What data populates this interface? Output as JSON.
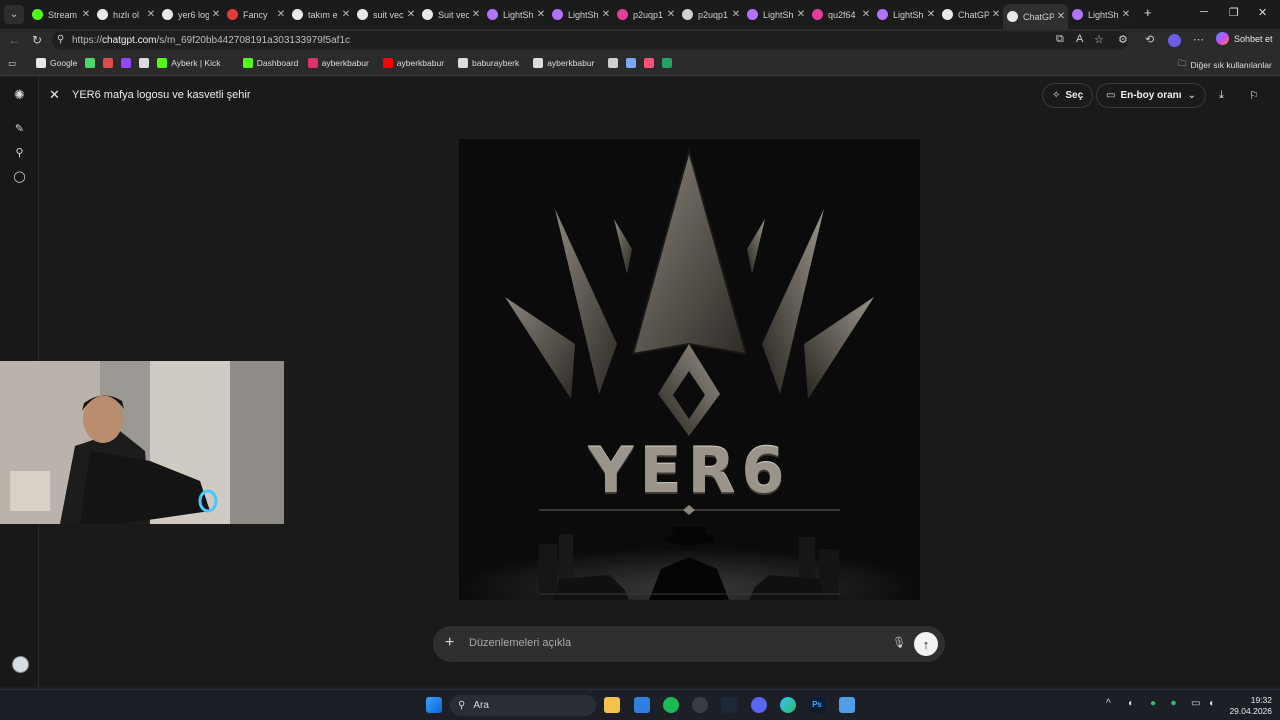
{
  "tabs": [
    {
      "title": "Stream",
      "icon": "kick-icon",
      "color": "#53fc18"
    },
    {
      "title": "hızlı ol",
      "icon": "google-icon",
      "color": "#e8e8e8"
    },
    {
      "title": "yer6 log",
      "icon": "google-icon",
      "color": "#e8e8e8"
    },
    {
      "title": "Fancy",
      "icon": "fancy-icon",
      "color": "#e03b3b"
    },
    {
      "title": "takım e",
      "icon": "google-icon",
      "color": "#e8e8e8"
    },
    {
      "title": "suit vec",
      "icon": "google-icon",
      "color": "#e8e8e8"
    },
    {
      "title": "Suit vec",
      "icon": "suit-icon",
      "color": "#e8e8e8"
    },
    {
      "title": "LightSh",
      "icon": "lightshot-icon",
      "color": "#b074ff"
    },
    {
      "title": "LightSh",
      "icon": "lightshot-icon",
      "color": "#b074ff"
    },
    {
      "title": "p2uqp1",
      "icon": "hash-icon",
      "color": "#e0409a"
    },
    {
      "title": "p2uqp1",
      "icon": "globe-icon",
      "color": "#d0d0d0"
    },
    {
      "title": "LightSh",
      "icon": "lightshot-icon",
      "color": "#b074ff"
    },
    {
      "title": "qu2f64",
      "icon": "hash-icon",
      "color": "#e0409a"
    },
    {
      "title": "LightSh",
      "icon": "lightshot-icon",
      "color": "#b074ff"
    },
    {
      "title": "ChatGP",
      "icon": "chatgpt-icon",
      "color": "#e8e8e8"
    },
    {
      "title": "ChatGP",
      "icon": "chatgpt-icon",
      "color": "#e8e8e8",
      "active": true
    },
    {
      "title": "LightSh",
      "icon": "lightshot-icon",
      "color": "#b074ff"
    }
  ],
  "address": {
    "url_prefix": "https://",
    "url_host": "chatgpt.com",
    "url_path": "/s/m_69f20bb442708191a303133979f5af1c",
    "copilot_label": "Sohbet et"
  },
  "bookmarks": [
    {
      "label": "Google",
      "color": "#e8e8e8"
    },
    {
      "label": "",
      "color": "#4ad66d"
    },
    {
      "label": "",
      "color": "#e04b4b"
    },
    {
      "label": "",
      "color": "#9146ff"
    },
    {
      "label": "",
      "color": "#dcdcdc"
    },
    {
      "label": "Ayberk | Kick",
      "color": "#53fc18"
    },
    {
      "label": "Dashboard",
      "color": "#53fc18"
    },
    {
      "label": "ayberkbabur",
      "color": "#e1306c"
    },
    {
      "label": "ayberkbabur",
      "color": "#ff0000"
    },
    {
      "label": "baburayberk",
      "color": "#dcdcdc"
    },
    {
      "label": "ayberkbabur",
      "color": "#dcdcdc"
    },
    {
      "label": "",
      "color": "#cfcfcf"
    },
    {
      "label": "",
      "color": "#7aa7ff"
    },
    {
      "label": "",
      "color": "#ff4f7a"
    },
    {
      "label": "",
      "color": "#1fa463"
    }
  ],
  "bookmarks_other": "Diğer sık kullanılanlar",
  "viewer": {
    "title": "YER6 mafya logosu ve kasvetli şehir",
    "select_label": "Seç",
    "aspect_label": "En-boy oranı",
    "image_text": "YER6"
  },
  "composer": {
    "placeholder": "Düzenlemeleri açıkla"
  },
  "taskbar": {
    "search_label": "Ara",
    "time": "19:32",
    "date": "29.04.2026"
  },
  "colors": {
    "accent_kick": "#53fc18",
    "background": "#1a1a1a",
    "composer": "#2f2f2f"
  }
}
